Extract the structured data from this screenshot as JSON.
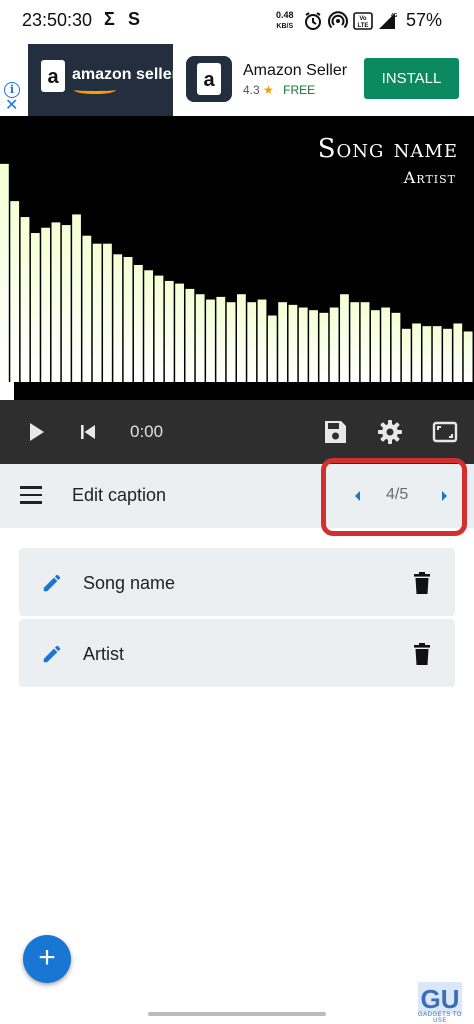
{
  "status_bar": {
    "time": "23:50:30",
    "network_speed_value": "0.48",
    "network_speed_unit": "KB/S",
    "volte_label": "Vo LTE",
    "network_type": "4G",
    "battery": "57%"
  },
  "ad": {
    "banner_text": "amazon seller",
    "title": "Amazon Seller",
    "rating": "4.3",
    "price": "FREE",
    "install_label": "INSTALL",
    "info_glyph": "i",
    "close_glyph": "✕"
  },
  "visualizer": {
    "song_name": "Song name",
    "artist": "Artist",
    "bar_levels": [
      0.82,
      0.68,
      0.62,
      0.56,
      0.58,
      0.6,
      0.59,
      0.63,
      0.55,
      0.52,
      0.52,
      0.48,
      0.47,
      0.44,
      0.42,
      0.4,
      0.38,
      0.37,
      0.35,
      0.33,
      0.31,
      0.32,
      0.3,
      0.33,
      0.3,
      0.31,
      0.25,
      0.3,
      0.29,
      0.28,
      0.27,
      0.26,
      0.28,
      0.33,
      0.3,
      0.3,
      0.27,
      0.28,
      0.26,
      0.2,
      0.22,
      0.21,
      0.21,
      0.2,
      0.22,
      0.19
    ],
    "bar_color_top": "#f5ffd4",
    "bar_color_bottom": "#ffffff"
  },
  "player": {
    "time": "0:00",
    "icons": [
      "play-icon",
      "skip-previous-icon",
      "save-icon",
      "settings-icon",
      "fullscreen-icon"
    ]
  },
  "caption_bar": {
    "title": "Edit caption",
    "page_indicator": "4/5"
  },
  "captions": [
    {
      "label": "Song name"
    },
    {
      "label": "Artist"
    }
  ],
  "fab": {
    "label": "+"
  },
  "watermark": {
    "logo": "GU",
    "text": "GADGETS TO USE"
  },
  "colors": {
    "accent_blue": "#1976d2",
    "highlight_red": "#d32f2f",
    "install_green": "#0b8a5f",
    "panel_gray": "#eceff1",
    "controls_dark": "#2e2e2e"
  }
}
